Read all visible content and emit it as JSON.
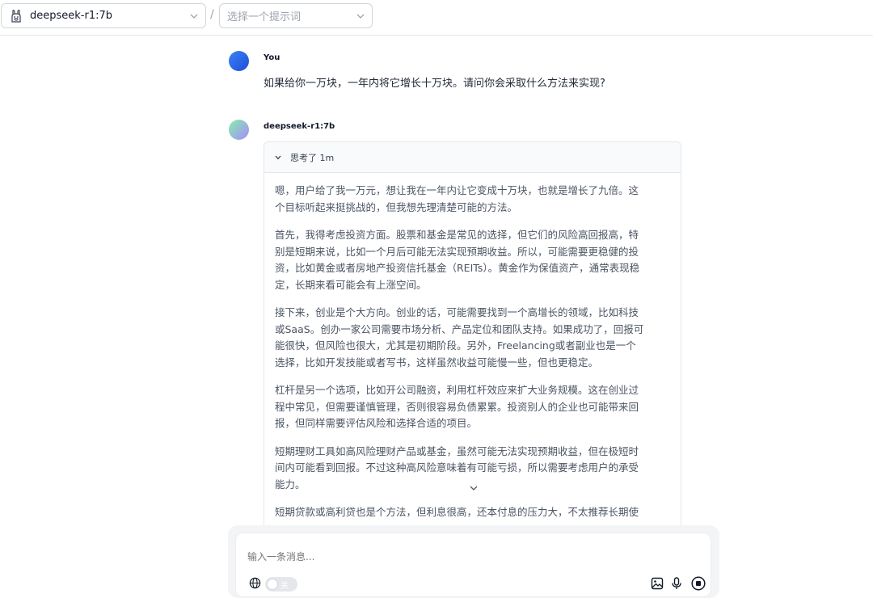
{
  "header": {
    "model_name": "deepseek-r1:7b",
    "separator": "/",
    "prompt_placeholder": "选择一个提示词"
  },
  "messages": [
    {
      "sender": "You",
      "text": "如果给你一万块，一年内将它增长十万块。请问你会采取什么方法来实现?"
    },
    {
      "sender": "deepseek-r1:7b"
    }
  ],
  "thinking": {
    "label": "思考了 1m",
    "paragraphs": [
      "嗯，用户给了我一万元，想让我在一年内让它变成十万块，也就是增长了九倍。这个目标听起来挺挑战的，但我想先理清楚可能的方法。",
      "首先，我得考虑投资方面。股票和基金是常见的选择，但它们的风险高回报高，特别是短期来说，比如一个月后可能无法实现预期收益。所以，可能需要更稳健的投资，比如黄金或者房地产投资信托基金（REITs）。黄金作为保值资产，通常表现稳定，长期来看可能会有上涨空间。",
      "接下来，创业是个大方向。创业的话，可能需要找到一个高增长的领域，比如科技或SaaS。创办一家公司需要市场分析、产品定位和团队支持。如果成功了，回报可能很快，但风险也很大，尤其是初期阶段。另外，Freelancing或者副业也是一个选择，比如开发技能或者写书，这样虽然收益可能慢一些，但也更稳定。",
      "杠杆是另一个选项，比如开公司融资，利用杠杆效应来扩大业务规模。这在创业过程中常见，但需要谨慎管理，否则很容易负债累累。投资别人的企业也可能带来回报，但同样需要评估风险和选择合适的项目。",
      "短期理财工具如高风险理财产品或基金，虽然可能无法实现预期收益，但在极短时间内可能看到回报。不过这种高风险意味着有可能亏损，所以需要考虑用户的承受能力。",
      "短期贷款或高利贷也是个方法，但利息很高，还本付息的压力大，不太推荐长期使"
    ]
  },
  "composer": {
    "placeholder": "输入一条消息...",
    "toggle_label": "关"
  },
  "icons": {
    "model_logo": "llama-icon",
    "globe": "globe-icon",
    "image": "image-icon",
    "mic": "microphone-icon",
    "stop": "stop-icon"
  }
}
